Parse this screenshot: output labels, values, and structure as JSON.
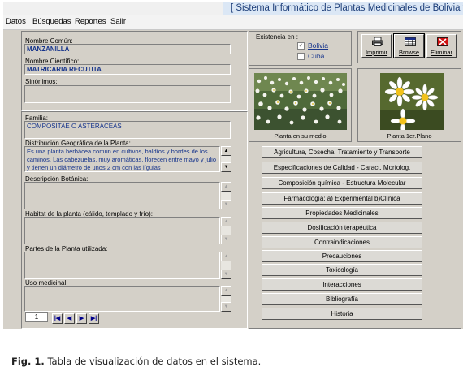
{
  "window": {
    "title": "[ Sistema Informático de Plantas Medicinales de Bolivia y C"
  },
  "menu": [
    "Datos",
    "Búsquedas",
    "Reportes",
    "Salir"
  ],
  "fields": {
    "nombre_comun": {
      "label": "Nombre Común:",
      "value": "MANZANILLA"
    },
    "nombre_cientifico": {
      "label": "Nombre Científico:",
      "value": "MATRICARIA RECUTITA"
    },
    "sinonimos": {
      "label": "Sinónimos:",
      "value": ""
    },
    "familia": {
      "label": "Familia:",
      "value": "COMPOSITAE O ASTERACEAS"
    },
    "distribucion": {
      "label": "Distribución Geográfica de la Planta:",
      "value": "Es una planta herbácea común en cultivos, baldíos y bordes de los caminos. Las cabezuelas, muy aromáticas, florecen entre mayo y julio y tienen un diámetro de unos 2 cm con las lígulas"
    },
    "descripcion": {
      "label": "Descripción Botánica:",
      "value": ""
    },
    "habitat": {
      "label": "Habitat de la planta (cálido, templado y frío):",
      "value": ""
    },
    "partes": {
      "label": "Partes de la Planta utilizada:",
      "value": ""
    },
    "uso": {
      "label": "Uso medicinal:",
      "value": ""
    }
  },
  "existencia": {
    "label": "Existencia en :",
    "options": [
      {
        "label": "Bolivia",
        "checked": true
      },
      {
        "label": "Cuba",
        "checked": false
      }
    ]
  },
  "toolbar": {
    "imprimir": "Imprimir",
    "browse": "Browse",
    "eliminar": "Eliminar"
  },
  "photos": {
    "medio": "Planta en su medio",
    "primer_plano": "Planta 1er.Plano"
  },
  "nav_buttons": [
    "Agricultura, Cosecha, Tratamiento y Transporte",
    "Especificaciones de Calidad - Caract. Morfolog.",
    "Composición química  - Estructura Molecular",
    "Farmacología: a) Experimental  b)Clínica",
    "Propiedades Medicinales",
    "Dosificación terapéutica",
    "Contraindicaciones",
    "Precauciones",
    "Toxicología",
    "Interacciones",
    "Bibliografía",
    "Historia"
  ],
  "record": {
    "number": "1"
  },
  "caption": {
    "label": "Fig. 1.",
    "text": "Tabla de visualización de datos en el sistema."
  },
  "colors": {
    "panel": "#d4d0c8",
    "field_text": "#16348c",
    "title_text": "#1e3f7a"
  }
}
